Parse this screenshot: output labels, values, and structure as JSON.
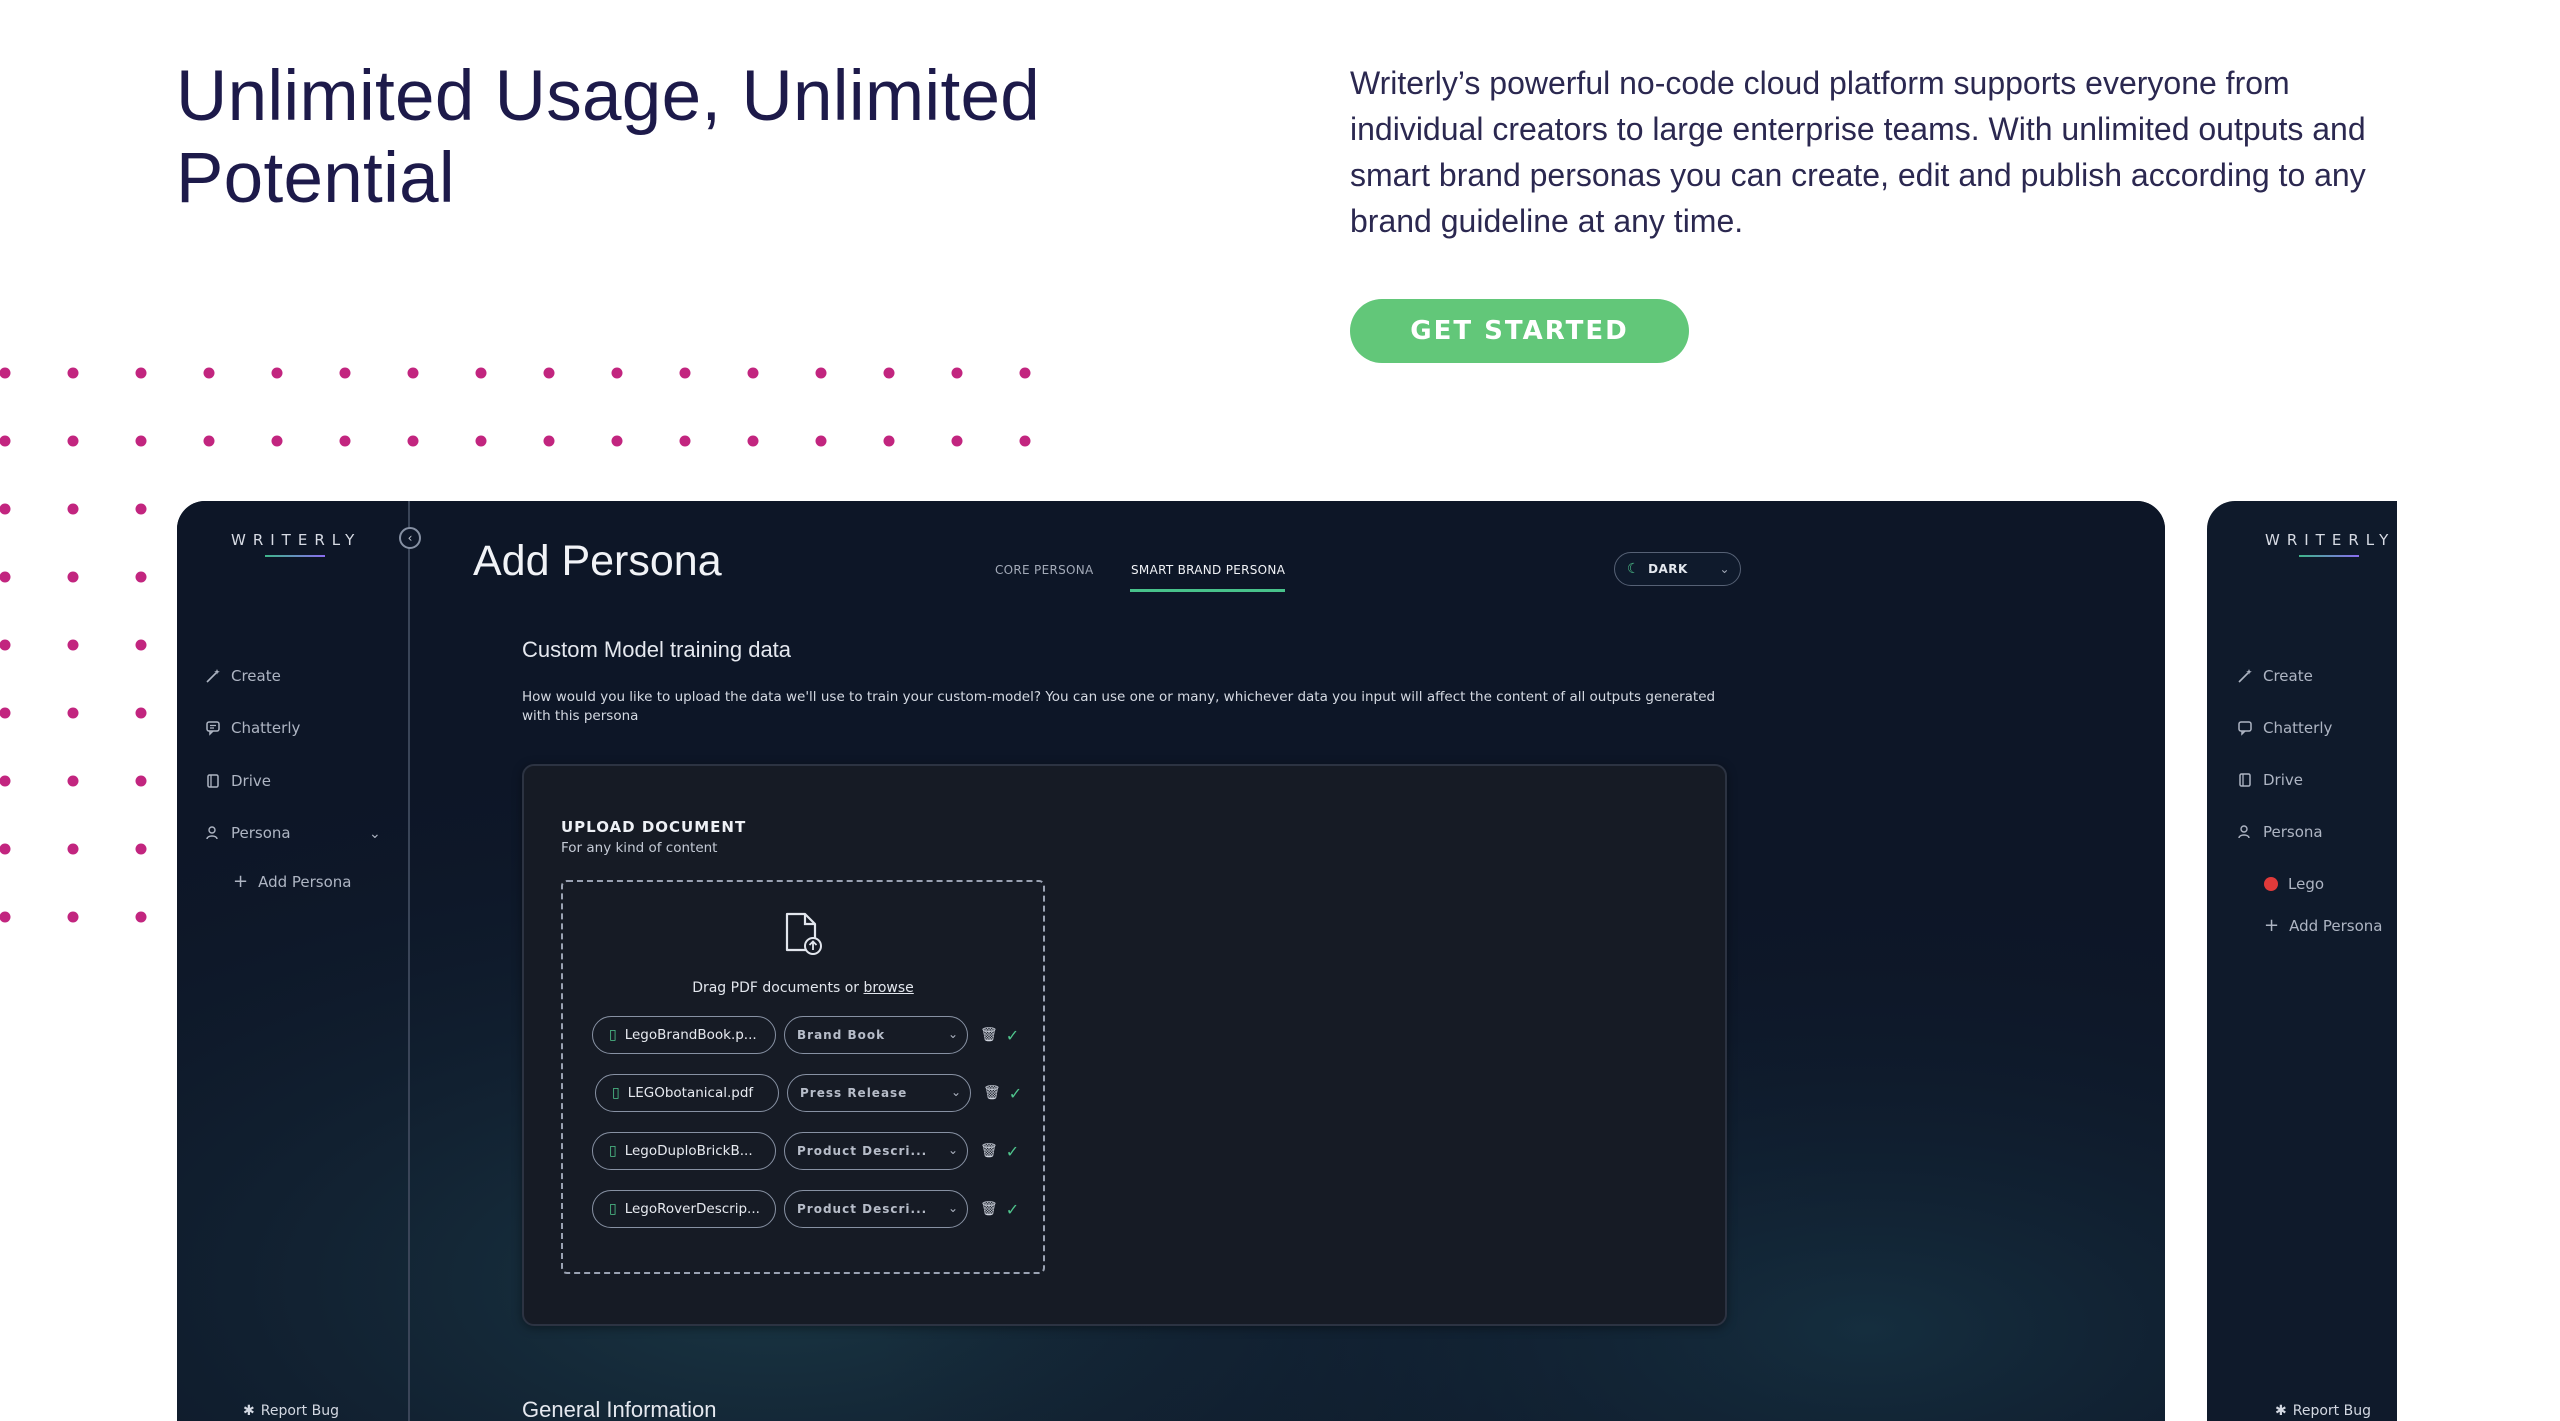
{
  "hero": {
    "title": "Unlimited Usage, Unlimited Potential",
    "description": "Writerly’s powerful no-code cloud platform supports everyone from individual creators to large enterprise teams. With unlimited outputs and smart brand personas you can create, edit and publish according to any brand guideline at any time.",
    "cta_label": "GET STARTED"
  },
  "colors": {
    "cta": "#62c779",
    "dots": "#c2257f",
    "app_bg": "#0e1729",
    "accent": "#48c28b"
  },
  "app": {
    "logo": "WRITERLY",
    "page_title": "Add Persona",
    "tabs": [
      {
        "label": "CORE PERSONA",
        "active": false
      },
      {
        "label": "SMART BRAND PERSONA",
        "active": true
      }
    ],
    "theme": {
      "label": "DARK",
      "icon": "moon-icon"
    },
    "nav": [
      {
        "label": "Create",
        "icon": "magic-wand-icon"
      },
      {
        "label": "Chatterly",
        "icon": "chat-icon"
      },
      {
        "label": "Drive",
        "icon": "drive-icon"
      },
      {
        "label": "Persona",
        "icon": "persona-icon"
      }
    ],
    "add_persona_label": "Add Persona",
    "report_bug_label": "Report Bug",
    "section_title": "Custom Model training data",
    "section_desc": "How would you like to upload the data we'll use to train your custom-model? You can use one or many, whichever data you input will affect the content of all outputs generated with this persona",
    "upload": {
      "title": "UPLOAD DOCUMENT",
      "subtitle": "For any kind of content",
      "drop_text": "Drag PDF documents or ",
      "browse_label": "browse",
      "files": [
        {
          "name": "LegoBrandBook.p...",
          "type": "Brand Book"
        },
        {
          "name": "LEGObotanical.pdf",
          "type": "Press Release"
        },
        {
          "name": "LegoDuploBrickB...",
          "type": "Product Descri..."
        },
        {
          "name": "LegoRoverDescrip...",
          "type": "Product Descri..."
        }
      ]
    },
    "general_info_title": "General Information"
  },
  "app2": {
    "logo": "WRITERLY",
    "nav": [
      {
        "label": "Create"
      },
      {
        "label": "Chatterly"
      },
      {
        "label": "Drive"
      },
      {
        "label": "Persona"
      }
    ],
    "persona_item": "Lego",
    "add_persona_label": "Add Persona",
    "report_bug_label": "Report Bug"
  }
}
